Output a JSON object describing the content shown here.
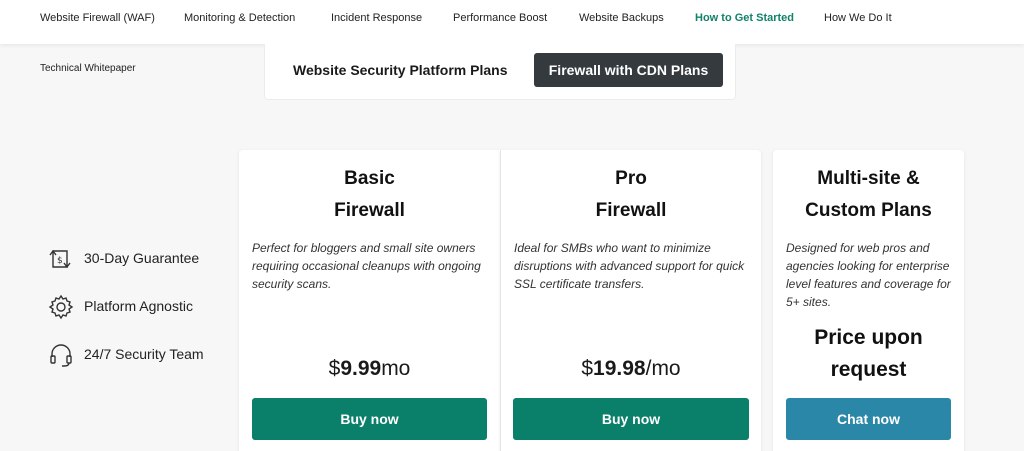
{
  "nav": {
    "items": [
      {
        "label": "Website Firewall (WAF)",
        "active": false
      },
      {
        "label": "Monitoring & Detection",
        "active": false
      },
      {
        "label": "Incident Response",
        "active": false
      },
      {
        "label": "Performance Boost",
        "active": false
      },
      {
        "label": "Website Backups",
        "active": false
      },
      {
        "label": "How to Get Started",
        "active": true
      },
      {
        "label": "How We Do It",
        "active": false
      }
    ],
    "secondary": "Technical Whitepaper"
  },
  "plan_toggle": {
    "option1": "Website Security Platform Plans",
    "option2": "Firewall with CDN Plans",
    "selected": "Firewall with CDN Plans"
  },
  "features": [
    {
      "label": "30-Day Guarantee",
      "icon": "money-back-icon"
    },
    {
      "label": "Platform Agnostic",
      "icon": "gear-icon"
    },
    {
      "label": "24/7 Security Team",
      "icon": "headset-icon"
    }
  ],
  "plans": [
    {
      "title_line1": "Basic",
      "title_line2": "Firewall",
      "description": "Perfect for bloggers and small site owners requiring occasional cleanups with ongoing security scans.",
      "currency": "$",
      "amount": "9.99",
      "period": "mo",
      "button": "Buy now"
    },
    {
      "title_line1": "Pro",
      "title_line2": "Firewall",
      "description": "Ideal for SMBs who want to minimize disruptions with advanced support for quick SSL certificate transfers.",
      "currency": "$",
      "amount": "19.98",
      "period": "/mo",
      "button": "Buy now"
    },
    {
      "title_line1": "Multi-site &",
      "title_line2": "Custom Plans",
      "description": "Designed for web pros and agencies looking for enterprise level features and coverage for 5+ sites.",
      "price_line1": "Price upon",
      "price_line2": "request",
      "button": "Chat now"
    }
  ],
  "colors": {
    "accent_green": "#0a7f6a",
    "accent_blue": "#2b87a8",
    "active_nav": "#12826b",
    "toggle_selected_bg": "#343a3e"
  }
}
